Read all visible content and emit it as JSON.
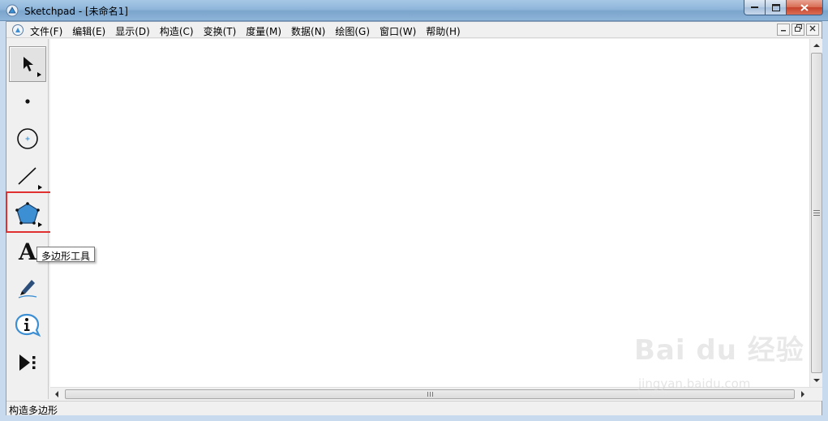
{
  "window": {
    "title": "Sketchpad - [未命名1]",
    "buttons": {
      "minimize": "minimize",
      "maximize": "maximize",
      "close": "close"
    }
  },
  "menubar": {
    "items": [
      {
        "label": "文件(F)"
      },
      {
        "label": "编辑(E)"
      },
      {
        "label": "显示(D)"
      },
      {
        "label": "构造(C)"
      },
      {
        "label": "变换(T)"
      },
      {
        "label": "度量(M)"
      },
      {
        "label": "数据(N)"
      },
      {
        "label": "绘图(G)"
      },
      {
        "label": "窗口(W)"
      },
      {
        "label": "帮助(H)"
      }
    ],
    "mdi_controls": [
      "minimize",
      "restore",
      "close"
    ]
  },
  "toolbox": {
    "tools": [
      {
        "icon": "arrow-select-icon",
        "active": true,
        "has_submenu": true
      },
      {
        "icon": "point-icon",
        "active": false,
        "has_submenu": false
      },
      {
        "icon": "compass-icon",
        "active": false,
        "has_submenu": false
      },
      {
        "icon": "straightedge-icon",
        "active": false,
        "has_submenu": true
      },
      {
        "icon": "polygon-icon",
        "active": false,
        "has_submenu": true,
        "highlighted": true
      },
      {
        "icon": "text-icon",
        "active": false,
        "has_submenu": false
      },
      {
        "icon": "marker-icon",
        "active": false,
        "has_submenu": false
      },
      {
        "icon": "info-icon",
        "active": false,
        "has_submenu": false
      },
      {
        "icon": "custom-tool-icon",
        "active": false,
        "has_submenu": false
      }
    ],
    "tooltip": "多边形工具",
    "highlight_color": "#e03030"
  },
  "statusbar": {
    "text": "构造多边形"
  },
  "watermark": {
    "brand": "Bai du 经验",
    "url": "jingyan.baidu.com"
  },
  "colors": {
    "titlebar": "#8fb6da",
    "polygon_fill": "#3d8fd4",
    "close_button": "#c6412a"
  }
}
